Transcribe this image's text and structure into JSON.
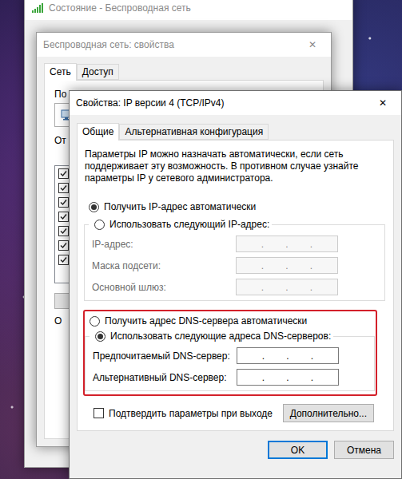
{
  "status_window": {
    "title": "Состояние - Беспроводная сеть"
  },
  "properties_window": {
    "title": "Беспроводная сеть: свойства",
    "close": "✕",
    "tabs": [
      {
        "label": "Сеть",
        "selected": true
      },
      {
        "label": "Доступ",
        "selected": false
      }
    ],
    "connect_label": "По",
    "components_label": "От",
    "components": [
      {
        "checked": true
      },
      {
        "checked": true
      },
      {
        "checked": true
      },
      {
        "checked": true
      },
      {
        "checked": true
      },
      {
        "checked": true
      },
      {
        "checked": true
      }
    ],
    "description_label": "О"
  },
  "ipv4_window": {
    "title": "Свойства: IP версии 4 (TCP/IPv4)",
    "close": "✕",
    "tabs": [
      {
        "label": "Общие",
        "selected": true
      },
      {
        "label": "Альтернативная конфигурация",
        "selected": false
      }
    ],
    "description": "Параметры IP можно назначать автоматически, если сеть поддерживает эту возможность. В противном случае узнайте параметры IP у сетевого администратора.",
    "ip_modes": [
      {
        "label": "Получить IP-адрес автоматически",
        "selected": true
      },
      {
        "label": "Использовать следующий IP-адрес:",
        "selected": false
      }
    ],
    "ip_fields": [
      {
        "label": "IP-адрес:",
        "disabled": true,
        "octets": [
          "",
          "",
          "",
          ""
        ]
      },
      {
        "label": "Маска подсети:",
        "disabled": true,
        "octets": [
          "",
          "",
          "",
          ""
        ]
      },
      {
        "label": "Основной шлюз:",
        "disabled": true,
        "octets": [
          "",
          "",
          "",
          ""
        ]
      }
    ],
    "dns_modes": [
      {
        "label": "Получить адрес DNS-сервера автоматически",
        "selected": false
      },
      {
        "label": "Использовать следующие адреса DNS-серверов:",
        "selected": true
      }
    ],
    "dns_fields": [
      {
        "label": "Предпочитаемый DNS-сервер:",
        "disabled": false,
        "octets": [
          "",
          "",
          "",
          ""
        ]
      },
      {
        "label": "Альтернативный DNS-сервер:",
        "disabled": false,
        "octets": [
          "",
          "",
          "",
          ""
        ]
      }
    ],
    "separator": ".",
    "confirm_on_exit": {
      "label": "Подтвердить параметры при выходе",
      "checked": false
    },
    "advanced_button": "Дополнительно...",
    "buttons": [
      {
        "label": "OK",
        "default": true
      },
      {
        "label": "Отмена",
        "default": false
      }
    ]
  }
}
